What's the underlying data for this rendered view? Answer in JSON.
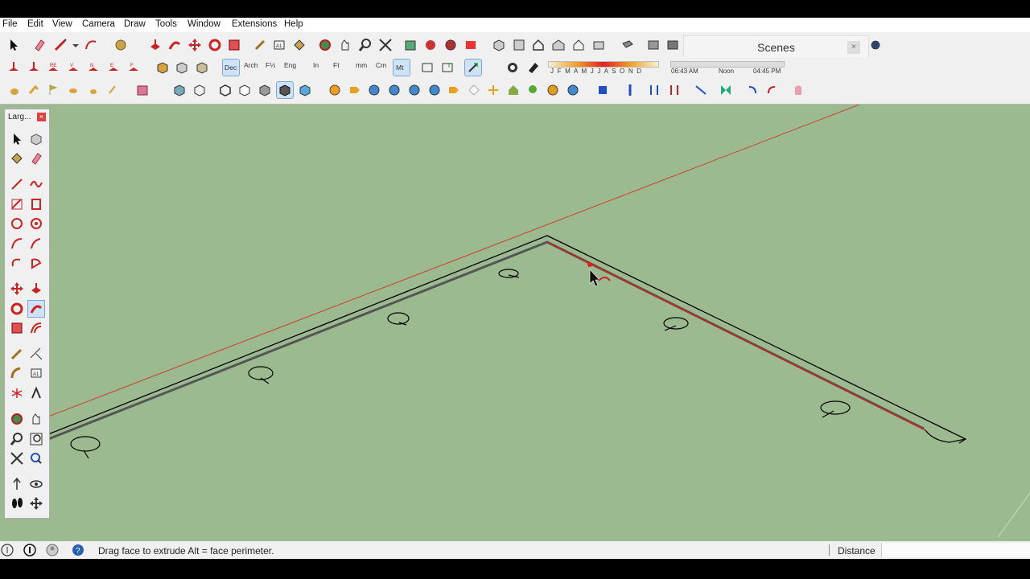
{
  "menu": [
    "File",
    "Edit",
    "View",
    "Camera",
    "Draw",
    "Tools",
    "Window",
    "Extensions",
    "Help"
  ],
  "units": {
    "dec": "Dec",
    "arch": "Arch",
    "frac": "F⅓",
    "eng": "Eng",
    "in": "In",
    "ft": "Ft",
    "mm": "mm",
    "cm": "Cm",
    "mt": "Mt"
  },
  "shadows": {
    "months": "J F M A M J J A S O N D",
    "time_start": "06:43 AM",
    "time_mid": "Noon",
    "time_end": "04:45 PM"
  },
  "scenes": {
    "title": "Scenes",
    "close": "×"
  },
  "palette": {
    "title": "Larg...",
    "close": "×"
  },
  "status": {
    "message": "Drag face to extrude  Alt = face perimeter.",
    "measure_label": "Distance",
    "measure_value": ""
  }
}
